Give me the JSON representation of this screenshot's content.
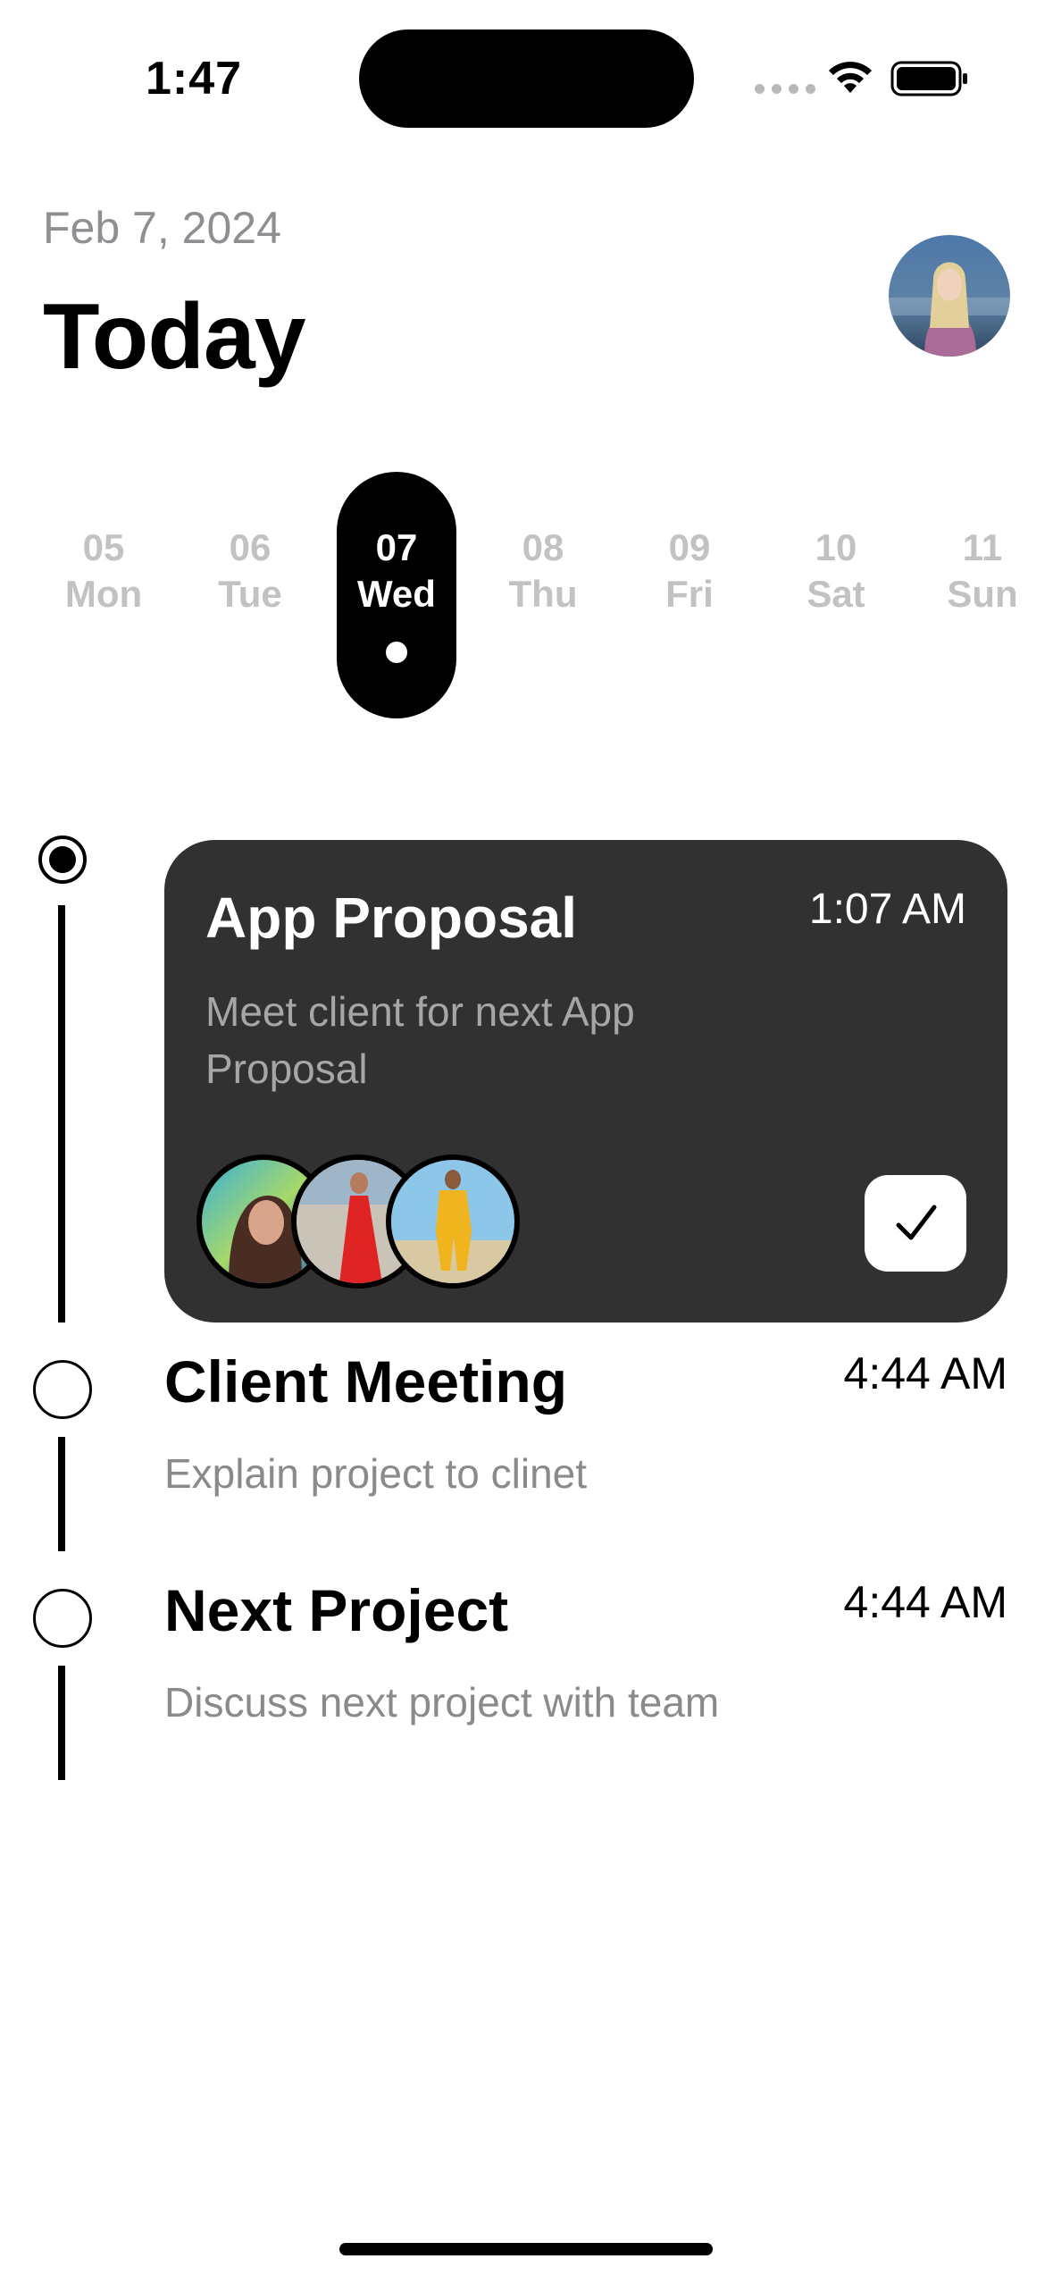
{
  "status_bar": {
    "time": "1:47"
  },
  "header": {
    "date": "Feb 7, 2024",
    "title": "Today"
  },
  "week": [
    {
      "num": "05",
      "name": "Mon"
    },
    {
      "num": "06",
      "name": "Tue"
    },
    {
      "num": "07",
      "name": "Wed"
    },
    {
      "num": "08",
      "name": "Thu"
    },
    {
      "num": "09",
      "name": "Fri"
    },
    {
      "num": "10",
      "name": "Sat"
    },
    {
      "num": "11",
      "name": "Sun"
    }
  ],
  "tasks": [
    {
      "title": "App Proposal",
      "time": "1:07 AM",
      "description": "Meet client for next App Proposal",
      "completed": true
    },
    {
      "title": "Client Meeting",
      "time": "4:44 AM",
      "description": "Explain project to clinet",
      "completed": false
    },
    {
      "title": "Next Project",
      "time": "4:44 AM",
      "description": "Discuss next project with team",
      "completed": false
    }
  ],
  "icons": {
    "wifi": "wifi-icon",
    "battery": "battery-icon",
    "check": "checkmark-icon"
  }
}
